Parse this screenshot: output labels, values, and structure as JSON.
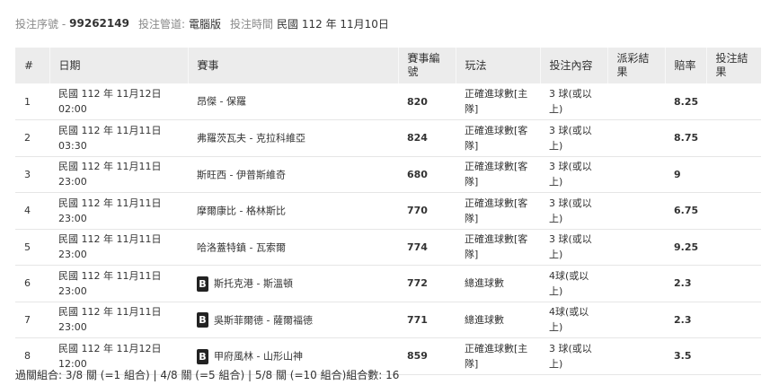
{
  "header": {
    "serial_label": "投注序號 -",
    "serial_value": "99262149",
    "channel_label": "投注管道:",
    "channel_value": "電腦版",
    "time_label": "投注時間",
    "time_value": "民國 112 年 11月10日"
  },
  "table": {
    "columns": [
      "#",
      "日期",
      "賽事",
      "賽事編號",
      "玩法",
      "投注內容",
      "派彩結果",
      "賠率",
      "投注結果"
    ],
    "rows": [
      {
        "no": "1",
        "date": "民國 112 年 11月12日 02:00",
        "badge": "",
        "event": "昂傑 - 保羅",
        "code": "820",
        "play": "正確進球數[主隊]",
        "content": "3 球(或以上)",
        "payout": "",
        "odds": "8.25",
        "result": ""
      },
      {
        "no": "2",
        "date": "民國 112 年 11月11日 03:30",
        "badge": "",
        "event": "弗羅茨瓦夫 - 克拉科維亞",
        "code": "824",
        "play": "正確進球數[客隊]",
        "content": "3 球(或以上)",
        "payout": "",
        "odds": "8.75",
        "result": ""
      },
      {
        "no": "3",
        "date": "民國 112 年 11月11日 23:00",
        "badge": "",
        "event": "斯旺西 - 伊普斯維奇",
        "code": "680",
        "play": "正確進球數[客隊]",
        "content": "3 球(或以上)",
        "payout": "",
        "odds": "9",
        "result": ""
      },
      {
        "no": "4",
        "date": "民國 112 年 11月11日 23:00",
        "badge": "",
        "event": "摩爾康比 - 格林斯比",
        "code": "770",
        "play": "正確進球數[客隊]",
        "content": "3 球(或以上)",
        "payout": "",
        "odds": "6.75",
        "result": ""
      },
      {
        "no": "5",
        "date": "民國 112 年 11月11日 23:00",
        "badge": "",
        "event": "哈洛蓋特鎮 - 瓦索爾",
        "code": "774",
        "play": "正確進球數[客隊]",
        "content": "3 球(或以上)",
        "payout": "",
        "odds": "9.25",
        "result": ""
      },
      {
        "no": "6",
        "date": "民國 112 年 11月11日 23:00",
        "badge": "B",
        "event": "斯托克港 - 斯溫頓",
        "code": "772",
        "play": "總進球數",
        "content": "4球(或以上)",
        "payout": "",
        "odds": "2.3",
        "result": ""
      },
      {
        "no": "7",
        "date": "民國 112 年 11月11日 23:00",
        "badge": "B",
        "event": "吳斯菲爾德 - 薩爾福德",
        "code": "771",
        "play": "總進球數",
        "content": "4球(或以上)",
        "payout": "",
        "odds": "2.3",
        "result": ""
      },
      {
        "no": "8",
        "date": "民國 112 年 11月12日 12:00",
        "badge": "B",
        "event": "甲府風林 - 山形山神",
        "code": "859",
        "play": "正確進球數[主隊]",
        "content": "3 球(或以上)",
        "payout": "",
        "odds": "3.5",
        "result": ""
      }
    ]
  },
  "footer": {
    "combo_text": "過關組合: 3/8 關 (=1 組合) | 4/8 關 (=5 組合) | 5/8 關 (=10 組合)組合數: 16"
  }
}
